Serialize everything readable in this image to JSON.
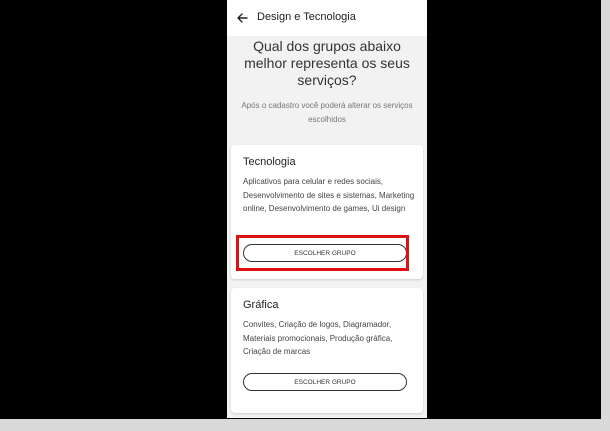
{
  "appbar": {
    "title": "Design e Tecnologia"
  },
  "header": {
    "question": "Qual dos grupos abaixo melhor representa os seus serviços?",
    "note": "Após o cadastro você poderá alterar os serviços escolhidos"
  },
  "groups": [
    {
      "title": "Tecnologia",
      "description": "Aplicativos para celular e redes sociais, Desenvolvimento de sites e sistemas, Marketing online, Desenvolvimento de games, Ui design",
      "button": "ESCOLHER GRUPO"
    },
    {
      "title": "Gráfica",
      "description": "Convites, Criação de logos, Diagramador, Materiais promocionais, Produção gráfica, Criação de marcas",
      "button": "ESCOLHER GRUPO"
    }
  ],
  "colors": {
    "highlight": "#e01010",
    "background": "#f2f2f2"
  }
}
